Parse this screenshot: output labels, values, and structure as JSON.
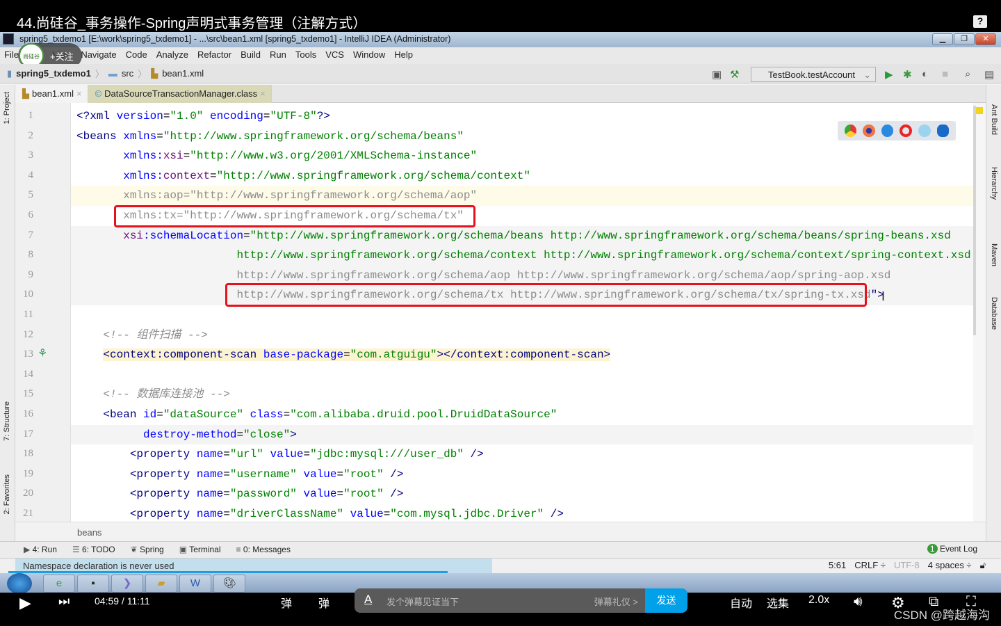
{
  "video": {
    "title": "44.尚硅谷_事务操作-Spring声明式事务管理（注解方式）",
    "help": "?",
    "time": "04:59 / 11:11",
    "danmu_placeholder": "发个弹幕见证当下",
    "danmu_etiquette": "弹幕礼仪 >",
    "send": "发送",
    "auto": "自动",
    "episodes": "选集",
    "speed": "2.0x",
    "follow": "+关注",
    "logo_text": "尚硅谷",
    "watermark": "CSDN @跨越海沟"
  },
  "window": {
    "title": "spring5_txdemo1 [E:\\work\\spring5_txdemo1] - ...\\src\\bean1.xml [spring5_txdemo1] - IntelliJ IDEA (Administrator)"
  },
  "menu": [
    "File",
    "Edit",
    "View",
    "Navigate",
    "Code",
    "Analyze",
    "Refactor",
    "Build",
    "Run",
    "Tools",
    "VCS",
    "Window",
    "Help"
  ],
  "breadcrumb": {
    "project": "spring5_txdemo1",
    "folder": "src",
    "file": "bean1.xml"
  },
  "run_config": "TestBook.testAccount",
  "tabs": [
    {
      "label": "bean1.xml"
    },
    {
      "label": "DataSourceTransactionManager.class"
    }
  ],
  "left_tools": [
    "1: Project",
    "7: Structure",
    "2: Favorites"
  ],
  "right_tools": [
    "Ant Build",
    "Hierarchy",
    "Maven",
    "Database"
  ],
  "code": [
    [
      [
        "<?xml ",
        "tag"
      ],
      [
        "version",
        "attr"
      ],
      [
        "=",
        "pun"
      ],
      [
        "\"1.0\"",
        "str"
      ],
      [
        " encoding",
        "attr"
      ],
      [
        "=",
        "pun"
      ],
      [
        "\"UTF-8\"",
        "str"
      ],
      [
        "?>",
        "tag"
      ]
    ],
    [
      [
        "<beans ",
        "tag"
      ],
      [
        "xmlns",
        "attr"
      ],
      [
        "=",
        "pun"
      ],
      [
        "\"http://www.springframework.org/schema/beans\"",
        "str"
      ]
    ],
    [
      [
        "       xmlns:",
        "attr"
      ],
      [
        "xsi",
        "ns"
      ],
      [
        "=",
        "pun"
      ],
      [
        "\"http://www.w3.org/2001/XMLSchema-instance\"",
        "str"
      ]
    ],
    [
      [
        "       xmlns:",
        "attr"
      ],
      [
        "context",
        "ns"
      ],
      [
        "=",
        "pun"
      ],
      [
        "\"http://www.springframework.org/schema/context\"",
        "str"
      ]
    ],
    [
      [
        "       xmlns:aop=\"http://www.springframework.org/schema/aop\"",
        "dim"
      ]
    ],
    [
      [
        "       xmlns:tx=\"http://www.springframework.org/schema/tx\"",
        "dim"
      ]
    ],
    [
      [
        "       ",
        "pun"
      ],
      [
        "xsi",
        "ns"
      ],
      [
        ":schemaLocation",
        "attr"
      ],
      [
        "=",
        "pun"
      ],
      [
        "\"http://www.springframework.org/schema/beans http://www.springframework.org/schema/beans/spring-beans.xsd",
        "str"
      ]
    ],
    [
      [
        "                        http://www.springframework.org/schema/context http://www.springframework.org/schema/context/spring-context.xsd",
        "str"
      ]
    ],
    [
      [
        "                        http://www.springframework.org/schema/aop http://www.springframework.org/schema/aop/spring-aop.xsd",
        "dim"
      ]
    ],
    [
      [
        "                        http://www.springframework.org/schema/tx http://www.springframework.org/schema/tx/spring-tx.xsd",
        "dim"
      ],
      [
        "\">",
        "tag"
      ]
    ],
    [],
    [
      [
        "    <!-- 组件扫描 -->",
        "cm"
      ]
    ],
    [
      [
        "    ",
        "pun"
      ],
      [
        "<context:component-scan ",
        "tag"
      ],
      [
        "base-package",
        "attr"
      ],
      [
        "=",
        "pun"
      ],
      [
        "\"com.atguigu\"",
        "str"
      ],
      [
        "></context:component-scan>",
        "tag"
      ]
    ],
    [],
    [
      [
        "    <!-- 数据库连接池 -->",
        "cm"
      ]
    ],
    [
      [
        "    <bean ",
        "tag"
      ],
      [
        "id",
        "attr"
      ],
      [
        "=",
        "pun"
      ],
      [
        "\"dataSource\"",
        "str"
      ],
      [
        " class",
        "attr"
      ],
      [
        "=",
        "pun"
      ],
      [
        "\"com.alibaba.druid.pool.DruidDataSource\"",
        "str"
      ]
    ],
    [
      [
        "          destroy-method",
        "attr"
      ],
      [
        "=",
        "pun"
      ],
      [
        "\"close\"",
        "str"
      ],
      [
        ">",
        "tag"
      ]
    ],
    [
      [
        "        <property ",
        "tag"
      ],
      [
        "name",
        "attr"
      ],
      [
        "=",
        "pun"
      ],
      [
        "\"url\"",
        "str"
      ],
      [
        " value",
        "attr"
      ],
      [
        "=",
        "pun"
      ],
      [
        "\"jdbc:mysql:///user_db\"",
        "str"
      ],
      [
        " />",
        "tag"
      ]
    ],
    [
      [
        "        <property ",
        "tag"
      ],
      [
        "name",
        "attr"
      ],
      [
        "=",
        "pun"
      ],
      [
        "\"username\"",
        "str"
      ],
      [
        " value",
        "attr"
      ],
      [
        "=",
        "pun"
      ],
      [
        "\"root\"",
        "str"
      ],
      [
        " />",
        "tag"
      ]
    ],
    [
      [
        "        <property ",
        "tag"
      ],
      [
        "name",
        "attr"
      ],
      [
        "=",
        "pun"
      ],
      [
        "\"password\"",
        "str"
      ],
      [
        " value",
        "attr"
      ],
      [
        "=",
        "pun"
      ],
      [
        "\"root\"",
        "str"
      ],
      [
        " />",
        "tag"
      ]
    ],
    [
      [
        "        <property ",
        "tag"
      ],
      [
        "name",
        "attr"
      ],
      [
        "=",
        "pun"
      ],
      [
        "\"driverClassName\"",
        "str"
      ],
      [
        " value",
        "attr"
      ],
      [
        "=",
        "pun"
      ],
      [
        "\"com.mysql.jdbc.Driver\"",
        "str"
      ],
      [
        " />",
        "tag"
      ]
    ]
  ],
  "editor_breadcrumb": "beans",
  "toolwindows": [
    "4: Run",
    "6: TODO",
    "Spring",
    "Terminal",
    "0: Messages"
  ],
  "event_log": {
    "count": "1",
    "label": "Event Log"
  },
  "status": {
    "message": "Namespace declaration is never used",
    "position": "5:61",
    "line_sep": "CRLF ÷",
    "encoding": "UTF-8",
    "indent": "4 spaces ÷"
  },
  "colors": {
    "highlight_box": "#e8101a",
    "accent": "#00a1e9"
  }
}
